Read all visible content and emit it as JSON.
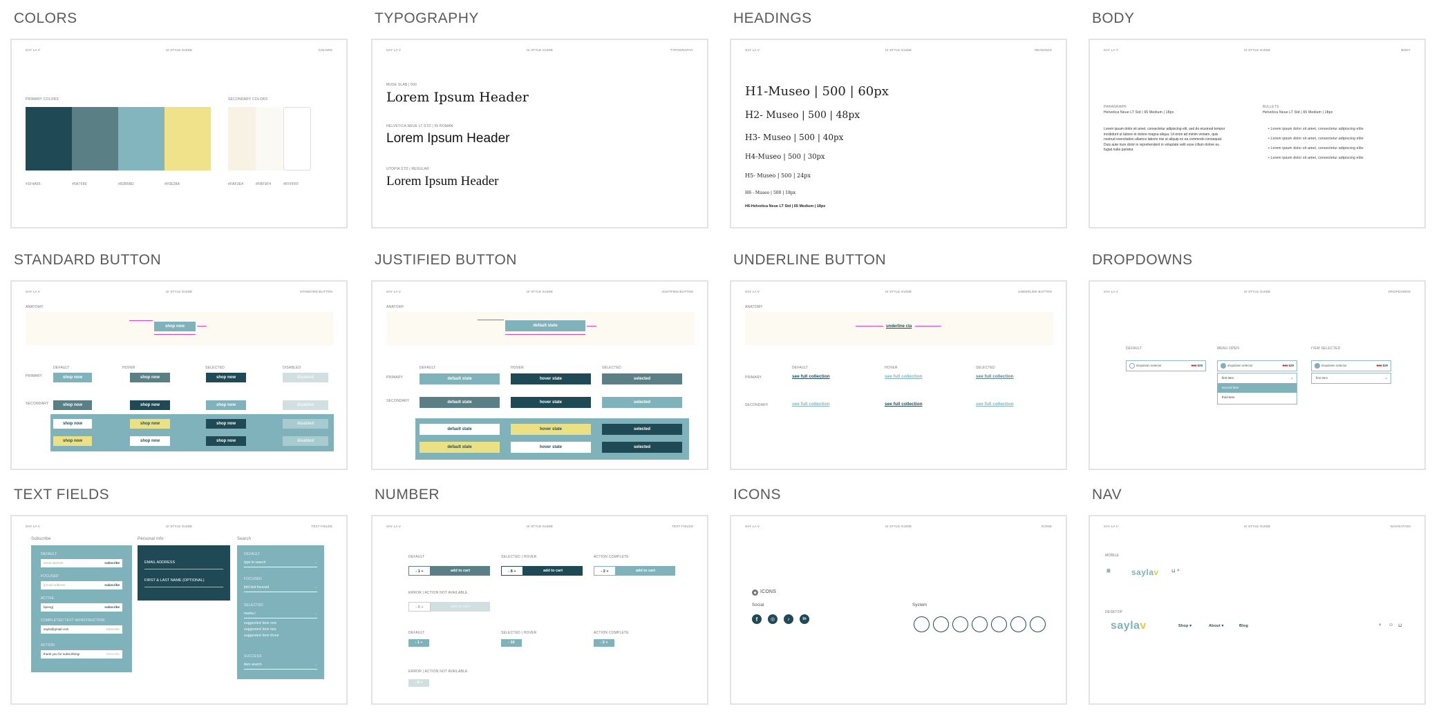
{
  "sections": {
    "colors": {
      "title": "COLORS",
      "hdr_left": "SAY LA V",
      "hdr_center": "UI STYLE GUIDE",
      "hdr_right": "COLORS",
      "primary_label": "PRIMARY COLORS",
      "secondary_label": "SECONDARY COLORS",
      "primary": [
        {
          "hex": "#1F4A55",
          "color": "#1f4a55"
        },
        {
          "hex": "#5A7F85",
          "color": "#5a7f85"
        },
        {
          "hex": "#82B5BD",
          "color": "#82b5bd"
        },
        {
          "hex": "#F0E28A",
          "color": "#f0e28a"
        }
      ],
      "secondary": [
        {
          "hex": "#FAF3E4",
          "color": "#f8f2e4"
        },
        {
          "hex": "#FBF9F4",
          "color": "#fbf9f4"
        },
        {
          "hex": "#FFFFFF",
          "color": "#ffffff"
        }
      ]
    },
    "typography": {
      "title": "TYPOGRAPHY",
      "hdr_left": "SAY LA V",
      "hdr_center": "UI STYLE GUIDE",
      "hdr_right": "TYPOGRAPHY",
      "samples": [
        {
          "label": "MUSE SLAB | 500",
          "text": "Lorem Ipsum Header"
        },
        {
          "label": "HELVETICA NEUE LT STD | 55 ROMAN",
          "text": "Lorem Ipsum Header"
        },
        {
          "label": "UTOPIA STD | REGULAR",
          "text": "Lorem Ipsum Header"
        }
      ]
    },
    "headings": {
      "title": "HEADINGS",
      "hdr_left": "SAY LA V",
      "hdr_center": "UI STYLE GUIDE",
      "hdr_right": "HEADINGS",
      "items": [
        "H1-Museo | 500 | 60px",
        "H2- Museo | 500 | 48px",
        "H3- Museo | 500 | 40px",
        "H4-Museo | 500 | 30px",
        "H5- Museo | 500 | 24px",
        "H6 - Museo | 500 | 18px",
        "H6-Helvetica Neue LT Std | 65 Medium | 18px"
      ]
    },
    "body": {
      "title": "BODY",
      "hdr_left": "SAY LA V",
      "hdr_center": "UI STYLE GUIDE",
      "hdr_right": "BODY",
      "para_label": "PARAGRAPH",
      "para_font": "Helvetica Neue LT Std | 65 Medium | 18px",
      "para_text": "Lorem ipsum dolor sit amet, consectetur adipiscing elit, sed do eiusmod tempor incididunt ut labore et dolore magna aliqua. Ut enim ad minim veniam, quis nostrud exercitation ullamco laboris nisi ut aliquip ex ea commodo consequat. Duis aute irure dolor in reprehenderit in voluptate velit esse cillum dolore eu fugiat nulla pariatur.",
      "bullets_label": "BULLETS",
      "bullets_font": "Helvetica Neue LT Std | 65 Medium | 18px",
      "bullets": [
        "Lorem ipsum dolor sit amet, consectetur adipiscing elite",
        "Lorem ipsum dolor sit amet, consectetur adipiscing elite",
        "Lorem ipsum dolor sit amet, consectetur adipiscing elite",
        "Lorem ipsum dolor sit amet, consectetur adipiscing elite"
      ]
    },
    "standard_button": {
      "title": "STANDARD BUTTON",
      "hdr_left": "SAY LA V",
      "hdr_center": "UI STYLE GUIDE",
      "hdr_right": "STANDARD BUTTON",
      "anatomy": "ANATOMY",
      "anatomy_btn": "shop now",
      "cols": [
        "DEFAULT",
        "HOVER",
        "SELECTED",
        "DISABLED"
      ],
      "row_primary": "PRIMARY",
      "row_secondary": "SECONDARY",
      "label": "shop now",
      "disabled": "disabled"
    },
    "justified_button": {
      "title": "JUSTIFIED BUTTON",
      "hdr_left": "SAY LA V",
      "hdr_center": "UI STYLE GUIDE",
      "hdr_right": "JUSTIFIED BUTTON",
      "anatomy": "ANATOMY",
      "anatomy_btn": "default state",
      "cols": [
        "DEFAULT",
        "HOVER",
        "SELECTED"
      ],
      "row_primary": "PRIMARY",
      "row_secondary": "SECONDARY",
      "default": "default state",
      "hover": "hover state",
      "selected": "selected"
    },
    "underline_button": {
      "title": "UNDERLINE BUTTON",
      "hdr_left": "SAY LA V",
      "hdr_center": "UI STYLE GUIDE",
      "hdr_right": "UNDERLINE BUTTON",
      "anatomy": "ANATOMY",
      "anatomy_link": "underline cta",
      "cols": [
        "DEFAULT",
        "HOVER",
        "SELECTED"
      ],
      "row_primary": "PRIMARY",
      "row_secondary": "SECONDARY",
      "link": "see full collection"
    },
    "dropdowns": {
      "title": "DROPDOWNS",
      "hdr_left": "SAY LA V",
      "hdr_center": "UI STYLE GUIDE",
      "hdr_right": "DROPDOWNS",
      "cols": [
        "DEFAULT",
        "MENU OPEN",
        "ITEM SELECTED"
      ],
      "selector": "dropdown selector",
      "old_price": "$44",
      "new_price": "$29",
      "first_item": "first item",
      "second_item": "second item",
      "third_item": "third item"
    },
    "text_fields": {
      "title": "TEXT FIELDS",
      "hdr_left": "SAY LA V",
      "hdr_center": "UI STYLE GUIDE",
      "hdr_right": "TEXT FIELDS",
      "subscribe": "Subscribe",
      "personal": "Personal info",
      "search": "Search",
      "sub_states": [
        {
          "label": "DEFAULT",
          "value": "email address",
          "btn": "subscribe"
        },
        {
          "label": "FOCUSED",
          "value": "||email address",
          "btn": "subscribe"
        },
        {
          "label": "ACTIVE",
          "value": "bpeng|",
          "btn": "subscribe"
        },
        {
          "label": "COMPLETED TEXT W/INSTRUCTION",
          "value": "sayla@gmail.com",
          "btn": "subscribe"
        },
        {
          "label": "ACTION",
          "value": "thank you for subscribing!",
          "btn": "subscribe"
        }
      ],
      "personal_fields": [
        "EMAIL ADDRESS",
        "FIRST & LAST NAME (OPTIONAL)"
      ],
      "search_states": [
        {
          "label": "DEFAULT",
          "value": "type to search"
        },
        {
          "label": "FOCUSED",
          "value": "|bld text focused"
        },
        {
          "label": "SELECTED",
          "value": "mama |"
        },
        {
          "label": "SUCCESS",
          "value": "item search"
        }
      ],
      "suggestions": [
        "suggested item one",
        "suggested item two",
        "suggested item three"
      ]
    },
    "number": {
      "title": "NUMBER",
      "hdr_left": "SAY LA V",
      "hdr_center": "UI STYLE GUIDE",
      "hdr_right": "TEXT FIELDS",
      "labels_a": [
        "DEFAULT",
        "SELECTED | HOVER",
        "ACTION COMPLETE"
      ],
      "error_a": "ERROR | ACTION NOT AVAILABLE",
      "labels_b": [
        "DEFAULT",
        "SELECTED | HOVER",
        "ACTION COMPLETE"
      ],
      "error_b": "ERROR | ACTION NOT AVAILABLE",
      "add": "add to cart",
      "qty_a": [
        "1",
        "8",
        "2"
      ],
      "qty_err": "0",
      "qty_b": [
        "1",
        "10",
        "2"
      ],
      "qty_err_b": "0"
    },
    "icons": {
      "title": "ICONS",
      "hdr_left": "SAY LA V",
      "hdr_center": "UI STYLE GUIDE",
      "hdr_right": "ICONS",
      "heading": "ICONS",
      "social": "Social",
      "system": "System",
      "social_icons": [
        "facebook-icon",
        "instagram-icon",
        "tiktok-icon",
        "linkedin-icon"
      ],
      "system_icons": [
        "drop-icon",
        "refresh-icon",
        "leaf-icon",
        "cloud-icon",
        "tree-icon",
        "person-icon",
        "plant-icon"
      ]
    },
    "nav": {
      "title": "NAV",
      "hdr_left": "SAY LA V",
      "hdr_center": "UI STYLE GUIDE",
      "hdr_right": "NAVIGATION",
      "mobile": "MOBILE",
      "desktop": "DESKTOP",
      "logo": "sayla",
      "logo_v": "v",
      "menu": [
        "Shop ▾",
        "About ▾",
        "Blog"
      ]
    }
  },
  "colors": {
    "dark": "#1f4a55",
    "mid": "#5a7f85",
    "teal": "#7fb2ba",
    "yellow": "#ece084",
    "cream": "#fdfaf2",
    "disabled": "#d2dfe1",
    "magenta": "#e040c0"
  }
}
